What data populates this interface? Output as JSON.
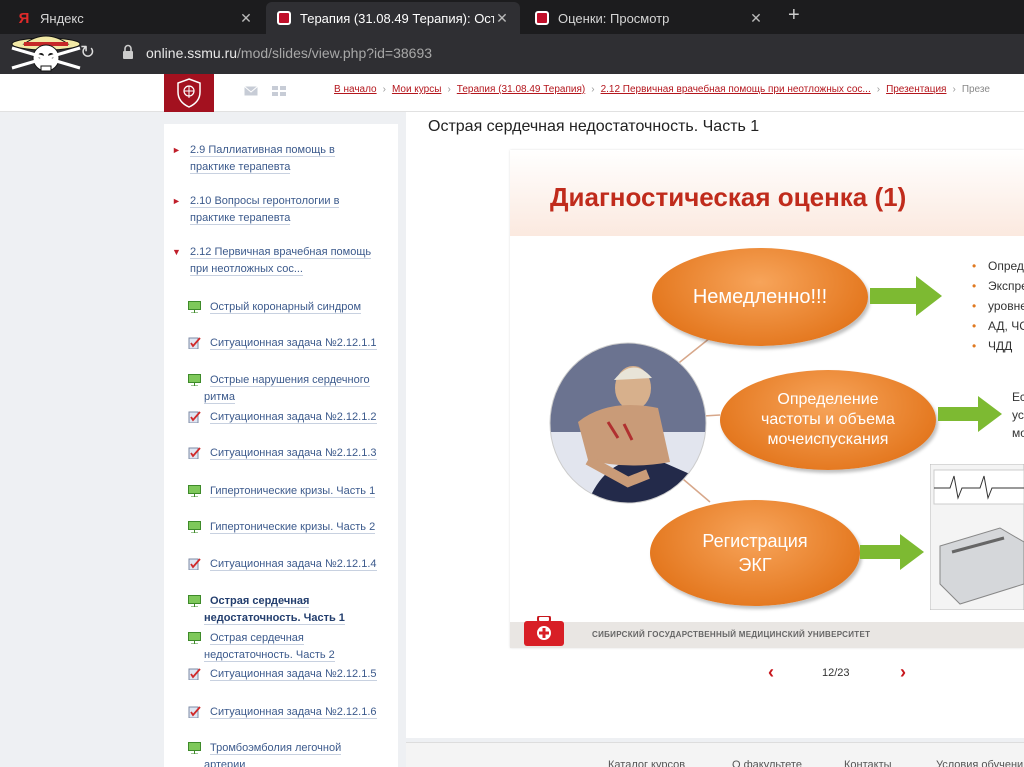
{
  "browser": {
    "tabs": [
      {
        "title": "Яндекс",
        "icon": "yandex-icon"
      },
      {
        "title": "Терапия (31.08.49 Терапия): Ост",
        "icon": "ssmu-crest-icon"
      },
      {
        "title": "Оценки: Просмотр",
        "icon": "ssmu-crest-icon"
      }
    ],
    "new_tab": "+",
    "url_host": "online.ssmu.ru",
    "url_path": "/mod/slides/view.php?id=38693"
  },
  "breadcrumbs": [
    "В начало",
    "Мои курсы",
    "Терапия (31.08.49 Терапия)",
    "2.12 Первичная врачебная помощь при неотложных сос...",
    "Презентация",
    "Презе"
  ],
  "sidebar": {
    "sections": [
      {
        "label": "2.9 Паллиативная помощь в практике терапевта",
        "expanded": false
      },
      {
        "label": "2.10 Вопросы геронтологии в практике терапевта",
        "expanded": false
      },
      {
        "label": "2.12 Первичная врачебная помощь при неотложных сос...",
        "expanded": true
      }
    ],
    "activities": [
      {
        "label": "Острый коронарный синдром",
        "icon": "presentation-icon"
      },
      {
        "label": "Ситуационная задача №2.12.1.1",
        "icon": "quiz-icon"
      },
      {
        "label": "Острые нарушения сердечного ритма",
        "icon": "presentation-icon"
      },
      {
        "label": "Ситуационная задача №2.12.1.2",
        "icon": "quiz-icon"
      },
      {
        "label": "Ситуационная задача №2.12.1.3",
        "icon": "quiz-icon"
      },
      {
        "label": "Гипертонические кризы. Часть 1",
        "icon": "presentation-icon"
      },
      {
        "label": "Гипертонические кризы. Часть 2",
        "icon": "presentation-icon"
      },
      {
        "label": "Ситуационная задача №2.12.1.4",
        "icon": "quiz-icon"
      },
      {
        "label": "Острая сердечная недостаточность. Часть 1",
        "icon": "presentation-icon",
        "current": true
      },
      {
        "label": "Острая сердечная недостаточность. Часть 2",
        "icon": "presentation-icon"
      },
      {
        "label": "Ситуационная задача №2.12.1.5",
        "icon": "quiz-icon"
      },
      {
        "label": "Ситуационная задача №2.12.1.6",
        "icon": "quiz-icon"
      },
      {
        "label": "Тромбоэмболия легочной артерии",
        "icon": "presentation-icon"
      }
    ]
  },
  "page_title": "Острая сердечная недостаточность. Часть 1",
  "slide": {
    "title": "Диагностическая оценка (1)",
    "ovals": [
      "Немедленно!!!",
      "Определение частоты и объема мочеиспускания",
      "Регистрация ЭКГ"
    ],
    "bullets": [
      "Определ",
      "Экспресс",
      "уровней",
      "АД, ЧСС",
      "ЧДД"
    ],
    "side_text": [
      "Ес",
      "ус",
      "мо"
    ],
    "footer_text": "Сибирский государственный медицинский университет"
  },
  "pager": {
    "current": "12/23",
    "prev": "‹",
    "next": "›"
  },
  "footer_links": [
    "Каталог курсов",
    "О факультете",
    "Контакты",
    "Условия обучени"
  ],
  "colors": {
    "brand": "#a3111f",
    "link": "#3c5a8c",
    "accent": "#e57a22",
    "arrow": "#7dba32"
  }
}
